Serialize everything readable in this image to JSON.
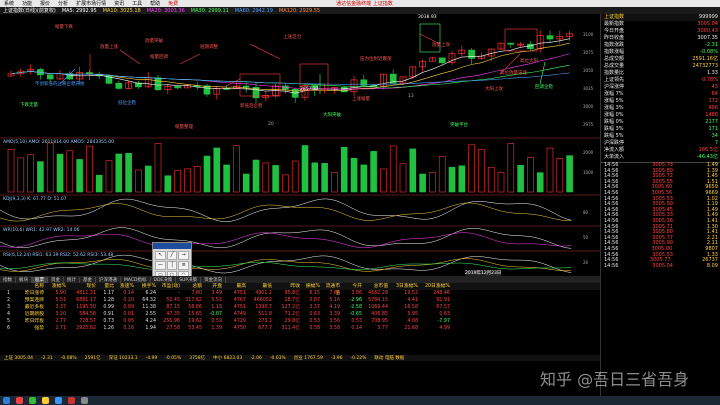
{
  "menu": {
    "items": [
      "系统",
      "功能",
      "报价",
      "分析",
      "扩展市场行情",
      "资讯",
      "工具",
      "帮助"
    ],
    "highlight": "免费",
    "center_title": "通达信金融终端 上证指数"
  },
  "toolbar": {
    "items": [
      "上证指数(日线)(前复权)",
      "MA5: 2992.95",
      "MA10: 3025.18",
      "MA20: 3003.36",
      "MA30: 2999.11",
      "MA60: 2942.19",
      "MA120: 2929.55"
    ]
  },
  "chart": {
    "price_high_label": "3038.93",
    "price_low_label": "2857.32",
    "axis_mid_label": "20",
    "axis_mid_label_2": "13",
    "volume_label": "AMO(5,10) AMO: 2611814.00 AMO5: 2843355.00",
    "sub1_label": "KDJ(9,3,3) K: 67.77 D: 51.07",
    "sub2_label": "WR(10,6) WR1: 42.97 WR2: 14.06",
    "sub3_label": "RSI(6,12,24) RSI1: 63.39 RSI2: 52.62 RSI3: 53.48",
    "date_label": "2019年12月23日",
    "annotations": [
      "缩量下跌",
      "放量上涨",
      "不创新低的止跌企稳开始",
      "放量突破",
      "下跌无量",
      "缩量回调",
      "低位企稳",
      "短期调整",
      "上涨乏力",
      "新低后企稳",
      "上涨缩量",
      "大阳突破",
      "压力位附近震荡",
      "放量上攻",
      "突破平台",
      "高位放量滞涨",
      "大阳上攻",
      "高位大阳",
      "回调企稳",
      "缩量整理"
    ]
  },
  "quote": {
    "header": "上证指数",
    "code": "999999",
    "rows": [
      {
        "label": "最新指数",
        "value": "3005.04",
        "cls": "red-t"
      },
      {
        "label": "今日开盘",
        "value": "3000.43",
        "cls": "red-t"
      },
      {
        "label": "昨日收盘",
        "value": "3007.35",
        "cls": "white-t"
      },
      {
        "label": "指数涨跌",
        "value": "-2.31",
        "cls": "green-t"
      },
      {
        "label": "指数涨幅",
        "value": "-0.08%",
        "cls": "green-t"
      },
      {
        "label": "总成交额",
        "value": "2591.16亿",
        "cls": "yellow-t"
      },
      {
        "label": "总成交量",
        "value": "24732773",
        "cls": "yellow-t"
      },
      {
        "label": "指数量比",
        "value": "1.33",
        "cls": "white-t"
      },
      {
        "label": "上证领先",
        "value": "0.78%",
        "cls": "red-t"
      },
      {
        "label": "沪深涨停",
        "value": "43",
        "cls": "red-t"
      },
      {
        "label": "涨幅 7%",
        "value": "84",
        "cls": "red-t"
      },
      {
        "label": "涨幅 5%",
        "value": "172",
        "cls": "red-t"
      },
      {
        "label": "涨幅 3%",
        "value": "406",
        "cls": "red-t"
      },
      {
        "label": "涨幅 0%",
        "value": "1488",
        "cls": "red-t"
      },
      {
        "label": "跌幅 0%",
        "value": "2177",
        "cls": "green-t"
      },
      {
        "label": "跌幅 3%",
        "value": "171",
        "cls": "green-t"
      },
      {
        "label": "跌幅 5%",
        "value": "34",
        "cls": "green-t"
      },
      {
        "label": "沪深跌停",
        "value": "7",
        "cls": "green-t"
      },
      {
        "label": "净流入额",
        "value": "186.5亿",
        "cls": "red-t"
      },
      {
        "label": "大单流入",
        "value": "-46.43亿",
        "cls": "green-t"
      }
    ],
    "ticks": [
      [
        "14:56",
        "3005.73",
        "1.49"
      ],
      [
        "14:56",
        "3005.80",
        "1.39"
      ],
      [
        "14:56",
        "3005.72",
        "1.45"
      ],
      [
        "14:56",
        "3005.55",
        "1.51"
      ],
      [
        "14:56",
        "3005.60",
        "9659"
      ],
      [
        "14:56",
        "3005.56",
        "9669"
      ],
      [
        "14:56",
        "3005.53",
        "1.02"
      ],
      [
        "14:56",
        "3005.50",
        "1.19"
      ],
      [
        "14:56",
        "3005.45",
        "1.49"
      ],
      [
        "14:56",
        "3005.33",
        "1.49"
      ],
      [
        "14:56",
        "3005.36",
        "1.41"
      ],
      [
        "14:56",
        "3005.71",
        "1.30"
      ],
      [
        "14:56",
        "3005.80",
        "1.41"
      ],
      [
        "14:56",
        "3005.77",
        "2.21"
      ],
      [
        "14:56",
        "3005.90",
        "2.11"
      ],
      [
        "14:56",
        "3005.00",
        "9807"
      ],
      [
        "14:56",
        "3005.53",
        "1.33"
      ],
      [
        "14:56",
        "3005.77",
        "26737"
      ],
      [
        "14:56",
        "3005.04",
        "8.09"
      ]
    ]
  },
  "tabs": [
    "指数",
    "板块",
    "股票",
    "资金",
    "统计",
    "基金",
    "沪深港通",
    "MACD指标",
    "DDE决策",
    "SUP决策",
    "资金流向"
  ],
  "table": {
    "headers": [
      "",
      "名称",
      "涨幅%",
      "现价",
      "量比",
      "涨速%",
      "换手%",
      "市盈(动)",
      "总额",
      "开盘",
      "最高",
      "最低",
      "昨收",
      "振幅%",
      "流通市值",
      "今开",
      "总市值",
      "3日涨幅%",
      "20日涨幅%"
    ],
    "rows": [
      [
        "1",
        "昨日涨停",
        "5.90",
        "4811.31",
        "1.17",
        "0.14",
        "6.24",
        "-",
        "7.60",
        "3.49",
        "4751",
        "4901.2",
        "95.8亿",
        "6.15",
        "7.64",
        "3.86",
        "4562.28",
        "19.52",
        "248.46"
      ],
      [
        "2",
        "预案连牌",
        "5.51",
        "6881.17",
        "1.28",
        "0.20",
        "64.32",
        "52.45",
        "317.82",
        "5.51",
        "4767",
        "466052",
        "18.7亿",
        "0.87",
        "5.16",
        "-2.96",
        "5784.15",
        "4.41",
        "91.91"
      ],
      [
        "3",
        "最近多板",
        "3.37",
        "1195.50",
        "0.99",
        "0.09",
        "11.38",
        "87.15",
        "56.86",
        "1.18",
        "4751",
        "1390.7",
        "127.2亿",
        "3.37",
        "4.19",
        "-2.58",
        "1069.44",
        "16.58",
        "67.57"
      ],
      [
        "4",
        "近期新股",
        "3.20",
        "584.58",
        "0.91",
        "0.01",
        "2.55",
        "47.35",
        "15.65",
        "-0.07",
        "4749",
        "511.8",
        "71.2亿",
        "0.63",
        "3.39",
        "-0.65",
        "406.85",
        "5.95",
        "0.63"
      ],
      [
        "5",
        "昨日炸板",
        "2.77",
        "728.57",
        "0.73",
        "0.05",
        "4.24",
        "256.96",
        "19.62",
        "0.59",
        "4729",
        "273.1",
        "29.8亿",
        "0.53",
        "3.56",
        "0.53",
        "708.95",
        "4.08",
        "-7.97"
      ],
      [
        "6",
        "强势",
        "2.71",
        "2925.82",
        "1.26",
        "0.16",
        "1.94",
        "27.58",
        "53.45",
        "1.39",
        "4750",
        "677.7",
        "311.4亿",
        "0.58",
        "3.58",
        "0.14",
        "5.77",
        "21.68",
        "4.99"
      ]
    ]
  },
  "status": [
    "上证 3005.04",
    "-2.31",
    "-0.08%",
    "2591亿",
    "深证 10233.1",
    "-4.99",
    "-0.05%",
    "3758亿",
    "中小 6823.03",
    "-2.06",
    "-0.03%",
    "创业 1767.59",
    "-3.96",
    "-0.22%",
    "联动 电脑 数据"
  ],
  "watermark": "知乎 @吾日三省吾身",
  "colors": {
    "up": "#ff3030",
    "down": "#20c040",
    "ma5": "#ffffff",
    "ma10": "#ffd23a",
    "ma20": "#ff40ff",
    "ma30": "#40ff60",
    "ma60": "#4aa0ff"
  }
}
